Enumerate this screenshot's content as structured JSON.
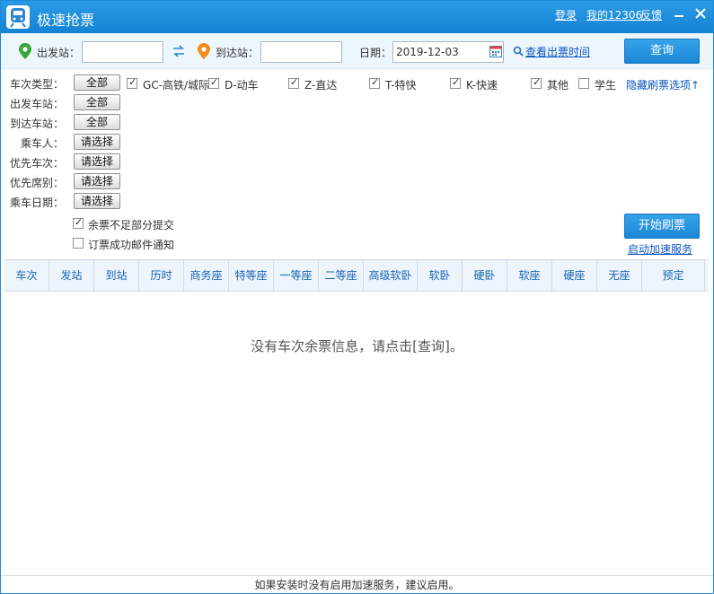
{
  "app": {
    "title": "极速抢票",
    "login_label": "登录",
    "my12306_label": "我的12306",
    "feedback_label": "反馈",
    "minimize_icon": "minimize-icon",
    "close_icon": "close-icon"
  },
  "search": {
    "from_label": "出发站：",
    "from_value": "",
    "to_label": "到达站：",
    "to_value": "",
    "date_label": "日期：",
    "date_value": "2019-12-03",
    "view_time_link": "查看出票时间",
    "query_button": "查询",
    "colors": {
      "from_pin": "#3aa63a",
      "to_pin": "#f08c1a",
      "accent": "#1b86d6"
    }
  },
  "filters": {
    "train_type_label": "车次类型：",
    "all_button": "全部",
    "train_types": [
      {
        "label": "GC-高铁/城际",
        "checked": true
      },
      {
        "label": "D-动车",
        "checked": true
      },
      {
        "label": "Z-直达",
        "checked": true
      },
      {
        "label": "T-特快",
        "checked": true
      },
      {
        "label": "K-快速",
        "checked": true
      },
      {
        "label": "其他",
        "checked": true
      },
      {
        "label": "学生",
        "checked": false
      }
    ],
    "hide_link": "隐藏刷票选项↑",
    "from_station_label": "出发车站：",
    "to_station_label": "到达车站：",
    "passenger_label": "乘车人：",
    "priority_train_label": "优先车次：",
    "priority_seat_label": "优先席别：",
    "ride_date_label": "乘车日期：",
    "select_button": "请选择",
    "partial_submit": {
      "label": "余票不足部分提交",
      "checked": true
    },
    "email_notify": {
      "label": "订票成功邮件通知",
      "checked": false
    },
    "start_button": "开始刷票",
    "accel_link": "启动加速服务"
  },
  "table": {
    "columns": [
      "车次",
      "发站",
      "到站",
      "历时",
      "商务座",
      "特等座",
      "一等座",
      "二等座",
      "高级软卧",
      "软卧",
      "硬卧",
      "软座",
      "硬座",
      "无座",
      "预定"
    ],
    "empty_message": "没有车次余票信息，请点击[查询]。"
  },
  "footer": {
    "text": "如果安装时没有启用加速服务，建议启用。"
  }
}
